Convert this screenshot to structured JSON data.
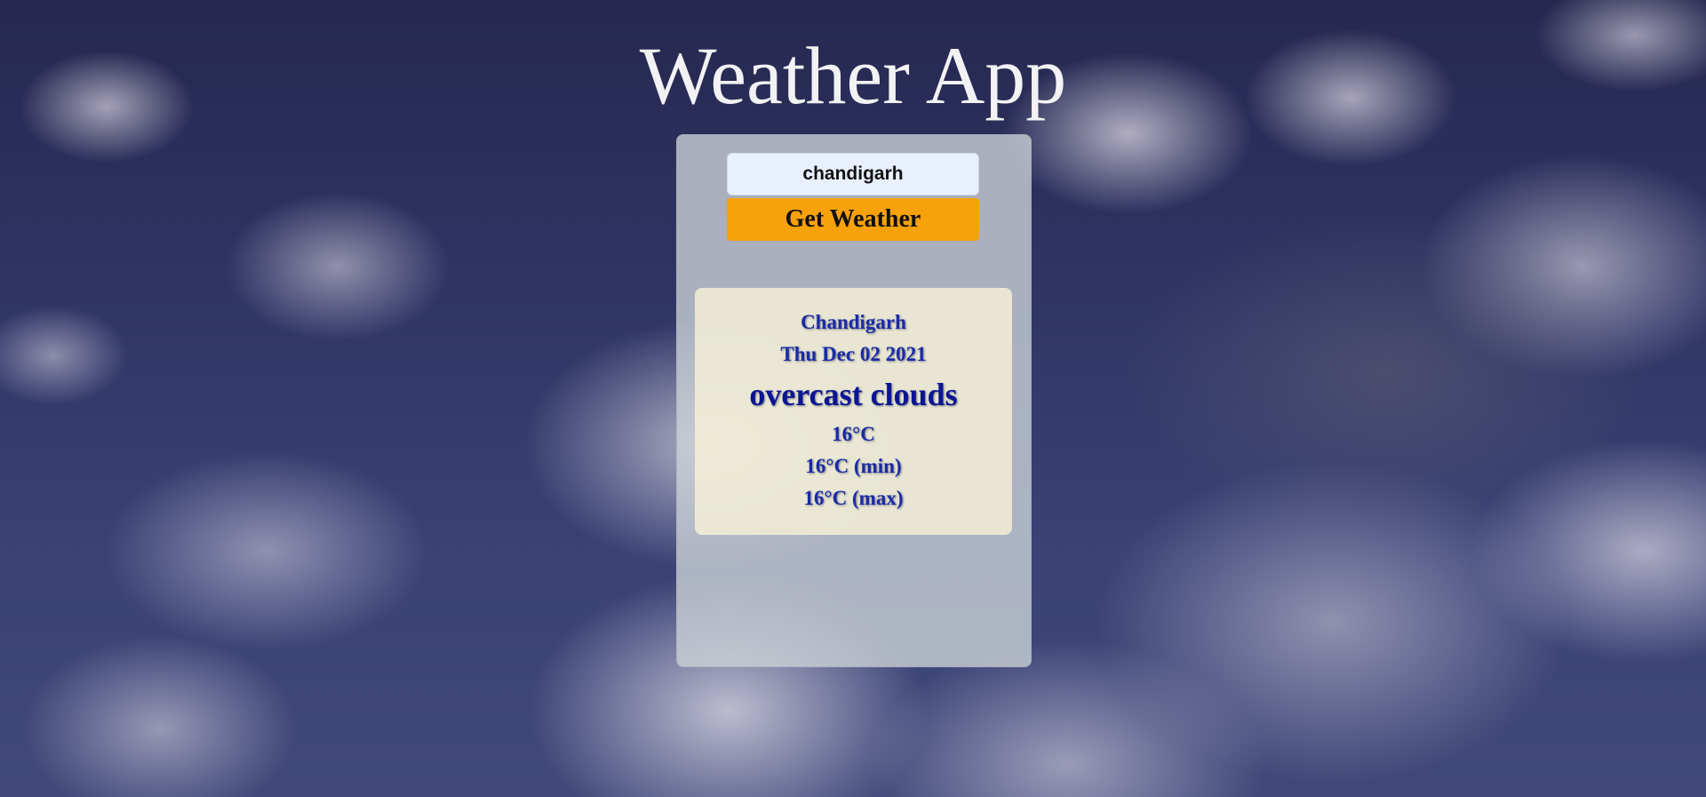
{
  "app": {
    "title": "Weather App"
  },
  "search": {
    "value": "chandigarh",
    "button_label": "Get Weather"
  },
  "weather": {
    "city": "Chandigarh",
    "date": "Thu Dec 02 2021",
    "description": "overcast clouds",
    "temp": "16°C",
    "temp_min": "16°C (min)",
    "temp_max": "16°C (max)"
  },
  "colors": {
    "button": "#f7a10b",
    "input_background": "#e8f0fe",
    "result_text": "#1a2aa8",
    "card_background": "#f5f2d7"
  }
}
